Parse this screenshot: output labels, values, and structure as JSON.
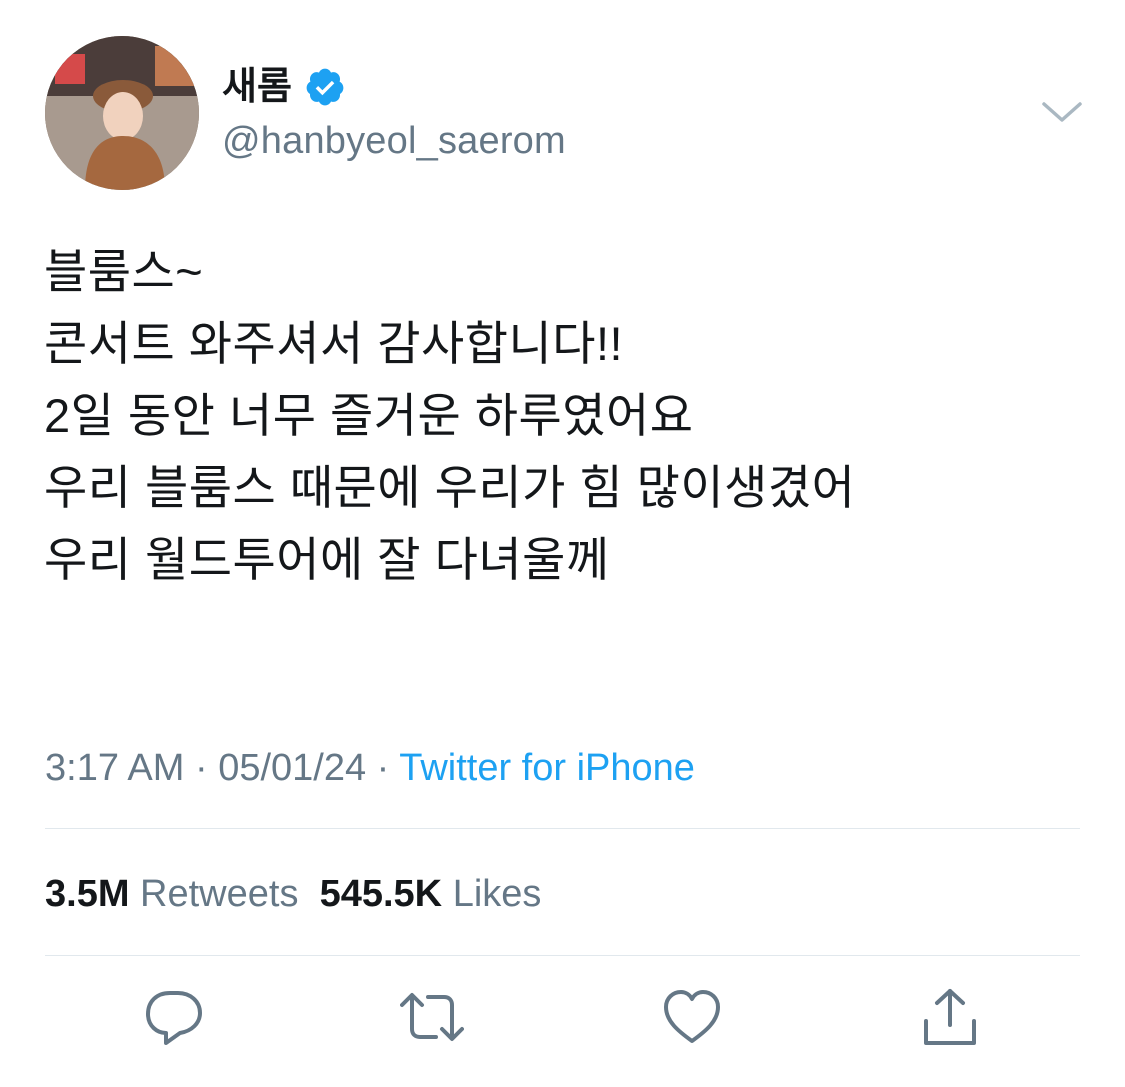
{
  "user": {
    "display_name": "새롬",
    "handle": "@hanbyeol_saerom",
    "avatar_icon": "avatar-photo",
    "verified_icon": "verified-badge-icon"
  },
  "tweet": {
    "text": "블룸스~\n콘서트 와주셔서 감사합니다!!\n2일 동안 너무 즐거운 하루였어요\n우리 블룸스 때문에 우리가 힘 많이생겼어\n우리 월드투어에 잘 다녀울께",
    "time": "3:17 AM",
    "separator": " · ",
    "date": "05/01/24",
    "source": "Twitter for iPhone"
  },
  "stats": {
    "retweets_count": "3.5M",
    "retweets_label": "Retweets",
    "likes_count": "545.5K",
    "likes_label": "Likes"
  },
  "actions": {
    "reply_icon": "reply-icon",
    "retweet_icon": "retweet-icon",
    "like_icon": "heart-icon",
    "share_icon": "share-icon"
  },
  "colors": {
    "accent": "#1da1f2",
    "secondary_text": "#657786",
    "primary_text": "#14171a",
    "divider": "#e1e8ed"
  }
}
